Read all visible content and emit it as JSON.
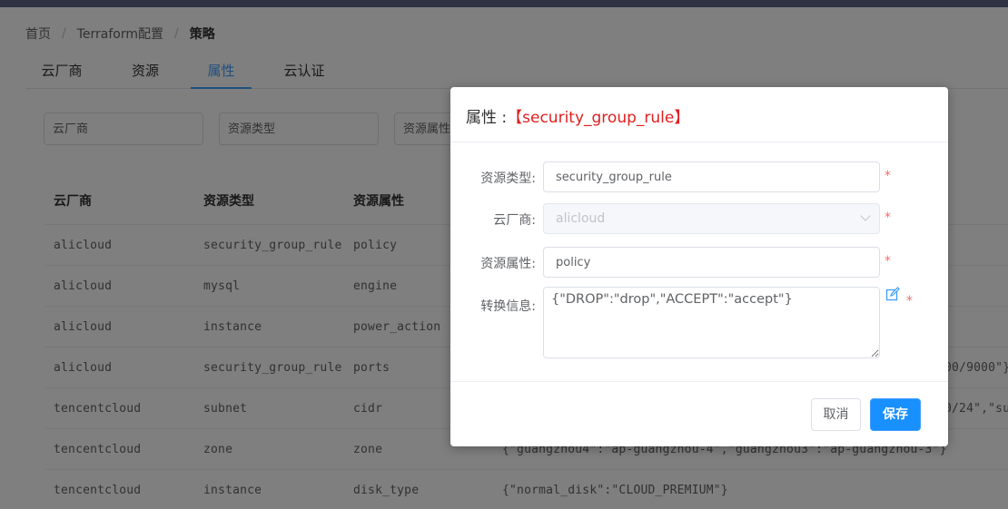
{
  "breadcrumb": [
    "首页",
    "Terraform配置",
    "策略"
  ],
  "tabs": [
    "云厂商",
    "资源",
    "属性",
    "云认证"
  ],
  "active_tab": 2,
  "filters": {
    "cloud_placeholder": "云厂商",
    "type_placeholder": "资源类型",
    "attr_placeholder": "资源属性"
  },
  "table": {
    "headers": [
      "云厂商",
      "资源类型",
      "资源属性",
      ""
    ],
    "rows": [
      [
        "alicloud",
        "security_group_rule",
        "policy",
        ""
      ],
      [
        "alicloud",
        "mysql",
        "engine",
        ""
      ],
      [
        "alicloud",
        "instance",
        "power_action",
        ""
      ],
      [
        "alicloud",
        "security_group_rule",
        "ports",
        "00/9000\"}"
      ],
      [
        "tencentcloud",
        "subnet",
        "cidr",
        "0/24\",\"sub"
      ],
      [
        "tencentcloud",
        "zone",
        "zone",
        "{\"guangzhou4\":\"ap-guangzhou-4\",\"guangzhou3\":\"ap-guangzhou-3\"}"
      ],
      [
        "tencentcloud",
        "instance",
        "disk_type",
        "{\"normal_disk\":\"CLOUD_PREMIUM\"}"
      ]
    ]
  },
  "dialog": {
    "title_prefix": "属性 :",
    "title_accent": "【security_group_rule】",
    "fields": {
      "type_label": "资源类型:",
      "type_value": "security_group_rule",
      "cloud_label": "云厂商:",
      "cloud_value": "alicloud",
      "attr_label": "资源属性:",
      "attr_value": "policy",
      "convert_label": "转换信息:",
      "convert_value": "{\"DROP\":\"drop\",\"ACCEPT\":\"accept\"}"
    },
    "required_mark": "*",
    "cancel_label": "取消",
    "save_label": "保存",
    "edit_icon": "edit-icon"
  },
  "colors": {
    "primary": "#409eff",
    "save_button": "#1890ff",
    "title_accent": "#e02020",
    "required": "#f56c6c",
    "topbar": "#2e3243"
  }
}
